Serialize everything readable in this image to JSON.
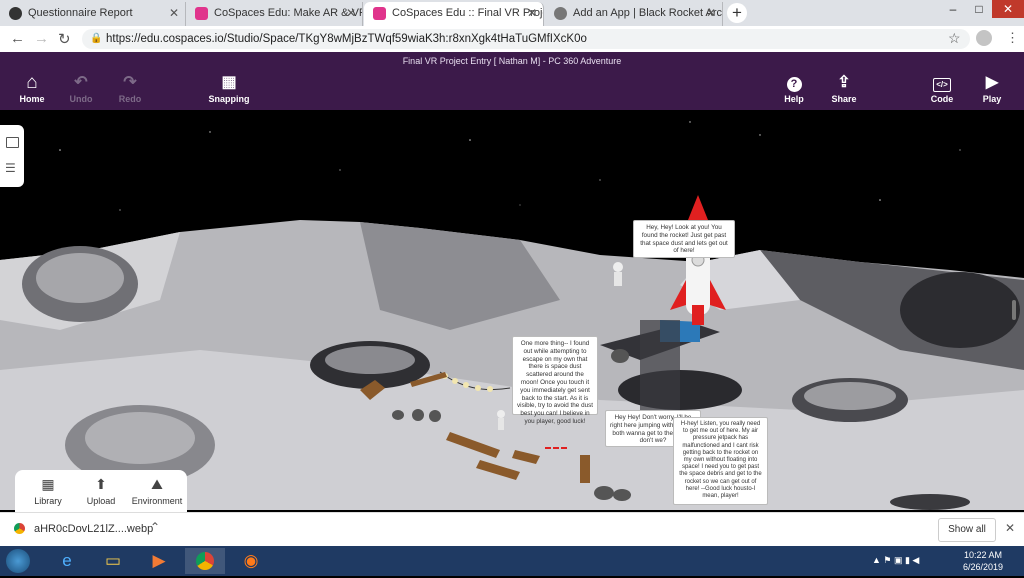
{
  "browser": {
    "tabs": [
      {
        "title": "Questionnaire Report",
        "fav_color": "#333333"
      },
      {
        "title": "CoSpaces Edu: Make AR & VR in",
        "fav_color": "#e0348c"
      },
      {
        "title": "CoSpaces Edu :: Final VR Project",
        "fav_color": "#e0348c"
      },
      {
        "title": "Add an App | Black Rocket Arcad",
        "fav_color": "#777777"
      }
    ],
    "active_tab": 2,
    "new_tab": "+",
    "url": "https://edu.cospaces.io/Studio/Space/TKgY8wMjBzTWqf59wiaK3h:r8xnXgk4tHaTuGMfIXcK0o",
    "window_controls": [
      "–",
      "□",
      "✕"
    ]
  },
  "cospaces": {
    "title": "Final VR Project Entry [ Nathan M] - PC 360 Adventure",
    "left_tools": [
      {
        "label": "Home",
        "icon": "home-icon",
        "glyph": "⌂"
      },
      {
        "label": "Undo",
        "icon": "undo-icon",
        "glyph": "↶"
      },
      {
        "label": "Redo",
        "icon": "redo-icon",
        "glyph": "↷"
      },
      {
        "label": "Snapping",
        "icon": "grid-icon",
        "glyph": "▦"
      }
    ],
    "right_tools": [
      {
        "label": "Help",
        "icon": "help-icon",
        "glyph": "?"
      },
      {
        "label": "Share",
        "icon": "share-icon",
        "glyph": "⇪"
      },
      {
        "label": "Code",
        "icon": "code-icon",
        "glyph": "</>"
      },
      {
        "label": "Play",
        "icon": "play-icon",
        "glyph": "▶"
      }
    ],
    "bottom_tools": [
      {
        "label": "Library",
        "icon": "library-icon",
        "glyph": "▦"
      },
      {
        "label": "Upload",
        "icon": "upload-icon",
        "glyph": "⬆"
      },
      {
        "label": "Environment",
        "icon": "environment-icon",
        "glyph": "⛰"
      }
    ],
    "bubbles": {
      "rocket": "Hey, Hey! Look at you! You found the rocket! Just get past that space dust and lets get out of here!",
      "escape": "One more thing-- I found out while attempting to escape on my own that there is space dust scattered around the moon! Once you touch it you immediately get sent back to the start. As it is visible, try to avoid the dust best you can! I believe in you player, good luck!",
      "jumping": "Hey Hey! Don't worry, I'll be right here jumping with joy! We both wanna get to the rocket, don't we?",
      "listen": "H-hey! Listen, you really need to get me out of here. My air pressure jetpack has malfunctioned and I cant risk getting back to the rocket on my own without floating into space! I need you to get past the space debris and get to the rocket so we can get out of here! --Good luck housto-I mean, player!"
    }
  },
  "download": {
    "file": "aHR0cDovL21lZ....webp",
    "show_all": "Show all"
  },
  "taskbar": {
    "time": "10:22 AM",
    "date": "6/26/2019"
  },
  "colors": {
    "cospaces_purple": "#3c1a4a",
    "taskbar": "#1f3a63",
    "rocket_red": "#e02020"
  }
}
